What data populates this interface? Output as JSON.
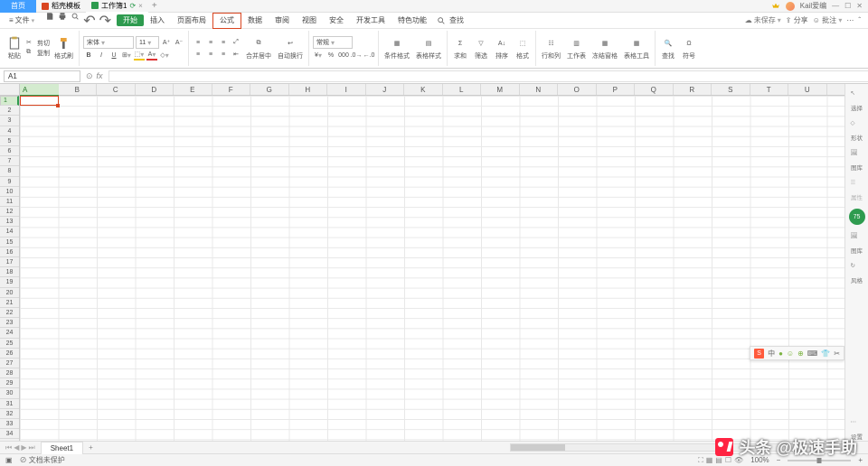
{
  "titlebar": {
    "home_label": "首页",
    "tab1": "稻壳模板",
    "tab2": "工作簿1",
    "user": "Kail爱编",
    "crown_badge": "1"
  },
  "menu": {
    "file_label": "文件",
    "tabs": [
      "开始",
      "插入",
      "页面布局",
      "公式",
      "数据",
      "审阅",
      "视图",
      "安全",
      "开发工具",
      "特色功能"
    ],
    "search": "查找",
    "unsaved": "未保存",
    "share": "分享",
    "note": "批注"
  },
  "ribbon": {
    "paste": "粘贴",
    "cut": "剪切",
    "copy": "复制",
    "format_painter": "格式刷",
    "font_name": "宋体",
    "font_size": "11",
    "merge_center": "合并居中",
    "wrap_text": "自动换行",
    "number_format": "常规",
    "cond_format": "条件格式",
    "table_style": "表格样式",
    "sum": "求和",
    "filter": "筛选",
    "sort": "排序",
    "format": "格式",
    "fill": "行和列",
    "worksheet": "工作表",
    "freeze": "冻结窗格",
    "table_tools": "表格工具",
    "find": "查找",
    "symbol": "符号"
  },
  "formula_bar": {
    "active_cell": "A1",
    "fx": "fx"
  },
  "columns": [
    "A",
    "B",
    "C",
    "D",
    "E",
    "F",
    "G",
    "H",
    "I",
    "J",
    "K",
    "L",
    "M",
    "N",
    "O",
    "P",
    "Q",
    "R",
    "S",
    "T",
    "U"
  ],
  "rows": [
    "1",
    "2",
    "3",
    "4",
    "5",
    "6",
    "7",
    "8",
    "9",
    "10",
    "11",
    "12",
    "13",
    "14",
    "15",
    "16",
    "17",
    "18",
    "19",
    "20",
    "21",
    "22",
    "23",
    "24",
    "25",
    "26",
    "27",
    "28",
    "29",
    "30",
    "31",
    "32",
    "33",
    "34"
  ],
  "sidepanel": {
    "select": "选择",
    "shape": "形状",
    "gallery": "图库",
    "attr": "属性",
    "badge": "75",
    "pic": "图库",
    "style": "风格",
    "settings": "设置"
  },
  "sheettabs": {
    "sheet1": "Sheet1"
  },
  "statusbar": {
    "doc_protect": "文档未保护",
    "zoom": "100%"
  },
  "ime": {
    "lang": "中",
    "punct": "●",
    "emoji": "☺",
    "net": "⊕",
    "kb": "⌨",
    "hanger": "👕",
    "cut": "✂"
  },
  "watermark": "头条 @极速手助"
}
